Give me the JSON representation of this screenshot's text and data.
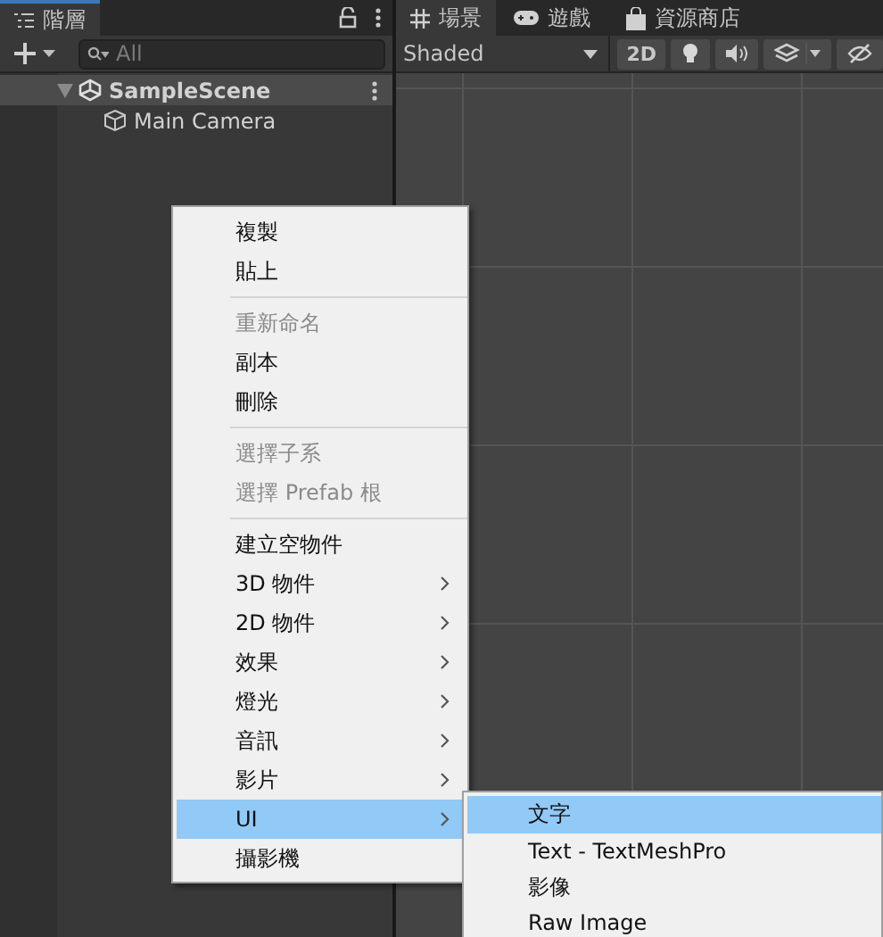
{
  "hierarchy": {
    "tab": {
      "label": "階層",
      "selected": true
    },
    "search": {
      "placeholder": "All"
    },
    "tree": [
      {
        "label": "SampleScene",
        "kind": "scene",
        "expanded": true,
        "children": [
          {
            "label": "Main Camera",
            "kind": "object"
          }
        ]
      }
    ]
  },
  "scene": {
    "tabs": [
      {
        "label": "場景",
        "kind": "scene",
        "selected": true
      },
      {
        "label": "遊戲",
        "kind": "game",
        "selected": false
      },
      {
        "label": "資源商店",
        "kind": "store",
        "selected": false
      }
    ],
    "shading": "Shaded",
    "mode_button": {
      "label": "2D",
      "on": false
    }
  },
  "context_menu": {
    "items": [
      {
        "kind": "item",
        "label": "複製",
        "disabled": false,
        "submenu": false,
        "selected": false
      },
      {
        "kind": "item",
        "label": "貼上",
        "disabled": false,
        "submenu": false,
        "selected": false
      },
      {
        "kind": "separator"
      },
      {
        "kind": "item",
        "label": "重新命名",
        "disabled": true,
        "submenu": false,
        "selected": false
      },
      {
        "kind": "item",
        "label": "副本",
        "disabled": false,
        "submenu": false,
        "selected": false
      },
      {
        "kind": "item",
        "label": "刪除",
        "disabled": false,
        "submenu": false,
        "selected": false
      },
      {
        "kind": "separator"
      },
      {
        "kind": "item",
        "label": "選擇子系",
        "disabled": true,
        "submenu": false,
        "selected": false
      },
      {
        "kind": "item",
        "label": "選擇 Prefab 根",
        "disabled": true,
        "submenu": false,
        "selected": false
      },
      {
        "kind": "separator"
      },
      {
        "kind": "item",
        "label": "建立空物件",
        "disabled": false,
        "submenu": false,
        "selected": false
      },
      {
        "kind": "item",
        "label": "3D 物件",
        "disabled": false,
        "submenu": true,
        "selected": false
      },
      {
        "kind": "item",
        "label": "2D 物件",
        "disabled": false,
        "submenu": true,
        "selected": false
      },
      {
        "kind": "item",
        "label": "效果",
        "disabled": false,
        "submenu": true,
        "selected": false
      },
      {
        "kind": "item",
        "label": "燈光",
        "disabled": false,
        "submenu": true,
        "selected": false
      },
      {
        "kind": "item",
        "label": "音訊",
        "disabled": false,
        "submenu": true,
        "selected": false
      },
      {
        "kind": "item",
        "label": "影片",
        "disabled": false,
        "submenu": true,
        "selected": false
      },
      {
        "kind": "item",
        "label": "UI",
        "disabled": false,
        "submenu": true,
        "selected": true
      },
      {
        "kind": "item",
        "label": "攝影機",
        "disabled": false,
        "submenu": false,
        "selected": false
      }
    ]
  },
  "submenu": {
    "items": [
      {
        "label": "文字",
        "selected": true
      },
      {
        "label": "Text - TextMeshPro",
        "selected": false
      },
      {
        "label": "影像",
        "selected": false
      },
      {
        "label": "Raw Image",
        "selected": false
      }
    ]
  }
}
